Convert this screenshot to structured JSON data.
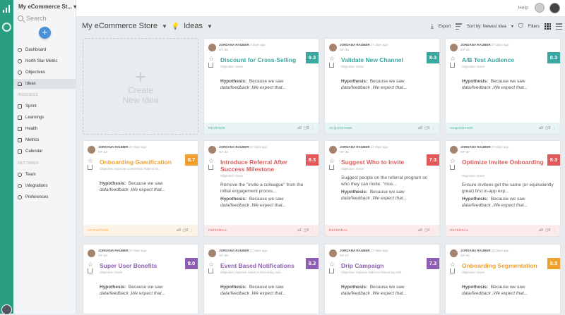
{
  "sidebar": {
    "store_name": "My eCommerce St...",
    "search_label": "Search",
    "add_label": "+",
    "items": [
      {
        "label": "Dashboard"
      },
      {
        "label": "North Star Metric"
      },
      {
        "label": "Objectives"
      },
      {
        "label": "Ideas"
      }
    ],
    "process_label": "PROCESS",
    "process_items": [
      {
        "label": "Sprint"
      },
      {
        "label": "Learnings"
      },
      {
        "label": "Health"
      },
      {
        "label": "Metrics"
      },
      {
        "label": "Calendar"
      }
    ],
    "settings_label": "SETTINGS",
    "settings_items": [
      {
        "label": "Team"
      },
      {
        "label": "Integrations"
      },
      {
        "label": "Preferences"
      }
    ]
  },
  "topbar": {
    "help": "Help"
  },
  "header": {
    "store": "My eCommerce Store",
    "section": "Ideas",
    "export": "Export",
    "sort": "Sort by: Newest Idea",
    "filters": "Filters"
  },
  "create_card": {
    "plus": "+",
    "line1": "Create",
    "line2": "New Idea"
  },
  "colors": {
    "teal": "#3aa8a0",
    "orange": "#f0a02f",
    "red": "#e05a5a",
    "purple": "#8e5fb0",
    "brand_green": "#2a9d80"
  },
  "cards": [
    {
      "author": "JORDANA RAUBER",
      "age": "3 days ago",
      "code": "GF-36",
      "title": "Discount for Cross-Selling",
      "score": "9.3",
      "objective": "Objective: None",
      "desc": "",
      "hyp_label": "Hypothesis:",
      "hyp1": "Because we saw",
      "hyp2": "data/feedback ,We expect that...",
      "category": "REVENUE",
      "links": "0",
      "comments": "0",
      "color": "#3aa8a0"
    },
    {
      "author": "JORDANA RAUBER",
      "age": "27 days ago",
      "code": "GF-35",
      "title": "Validate New Channel",
      "score": "8.3",
      "objective": "Objective: None",
      "desc": "",
      "hyp_label": "Hypothesis:",
      "hyp1": "Because we saw",
      "hyp2": "data/feedback ,We expect that...",
      "category": "ACQUISITION",
      "links": "0",
      "comments": "0",
      "color": "#3aa8a0"
    },
    {
      "author": "JORDANA RAUBER",
      "age": "27 days ago",
      "code": "GF-34",
      "title": "A/B Test Audience",
      "score": "8.3",
      "objective": "Objective: None",
      "desc": "",
      "hyp_label": "Hypothesis:",
      "hyp1": "Because we saw",
      "hyp2": "data/feedback ,We expect that...",
      "category": "ACQUISITION",
      "links": "0",
      "comments": "0",
      "color": "#3aa8a0"
    },
    {
      "author": "JORDANA RAUBER",
      "age": "27 days ago",
      "code": "GF-33",
      "title": "Onboarding Gamification",
      "score": "8.7",
      "objective": "Objective: Improve Conversion Rate of Or...",
      "desc": "",
      "hyp_label": "Hypothesis:",
      "hyp1": "Because we saw",
      "hyp2": "data/feedback ,We expect that...",
      "category": "ACTIVATION",
      "links": "0",
      "comments": "0",
      "color": "#f0a02f"
    },
    {
      "author": "JORDANA RAUBER",
      "age": "27 days ago",
      "code": "GF-32",
      "title": "Introduce Referral After Success Milestone",
      "score": "8.3",
      "objective": "Objective: None",
      "desc": "Remove the \"invite a colleague\" from the initial engagement proces...",
      "hyp_label": "Hypothesis:",
      "hyp1": "Because we saw",
      "hyp2": "data/feedback ,We expect that...",
      "category": "REFERRAL",
      "links": "1",
      "comments": "0",
      "color": "#e05a5a"
    },
    {
      "author": "JORDANA RAUBER",
      "age": "27 days ago",
      "code": "GF-31",
      "title": "Suggest Who to Invite",
      "score": "7.3",
      "objective": "Objective: None",
      "desc": "Suggest people on the referral program on who they can invite: \"mos...",
      "hyp_label": "Hypothesis:",
      "hyp1": "Because we saw",
      "hyp2": "data/feedback ,We expect that...",
      "category": "REFERRAL",
      "links": "0",
      "comments": "0",
      "color": "#e05a5a"
    },
    {
      "author": "JORDANA RAUBER",
      "age": "27 days ago",
      "code": "GF-30",
      "title": "Optimize Invitee Onboarding",
      "score": "8.3",
      "objective": "Objective: None",
      "desc": "Ensure invitees get the same (or equivalently great) first in-app exp...",
      "hyp_label": "Hypothesis:",
      "hyp1": "Because we saw",
      "hyp2": "data/feedback ,We expect that...",
      "category": "REFERRAL",
      "links": "0",
      "comments": "0",
      "color": "#e05a5a"
    },
    {
      "author": "JORDANA RAUBER",
      "age": "27 days ago",
      "code": "GF-29",
      "title": "Super User Benefits",
      "score": "8.0",
      "objective": "Objective: None",
      "desc": "",
      "hyp_label": "Hypothesis:",
      "hyp1": "Because we saw",
      "hyp2": "data/feedback ,We expect that...",
      "category": "",
      "links": "",
      "comments": "",
      "color": "#8e5fb0"
    },
    {
      "author": "JORDANA RAUBER",
      "age": "27 days ago",
      "code": "GF-28",
      "title": "Event Based Notifications",
      "score": "8.3",
      "objective": "Objective: Improve Sales to Recurring Visit...",
      "desc": "",
      "hyp_label": "Hypothesis:",
      "hyp1": "Because we saw",
      "hyp2": "data/feedback ,We expect that...",
      "category": "",
      "links": "",
      "comments": "",
      "color": "#8e5fb0"
    },
    {
      "author": "JORDANA RAUBER",
      "age": "27 days ago",
      "code": "GF-27",
      "title": "Drip Campaign",
      "score": "7.3",
      "objective": "Objective: Improve Sales to Recurring Visit",
      "desc": "",
      "hyp_label": "Hypothesis:",
      "hyp1": "Because we saw",
      "hyp2": "data/feedback ,We expect that...",
      "category": "",
      "links": "",
      "comments": "",
      "color": "#8e5fb0"
    },
    {
      "author": "JORDANA RAUBER",
      "age": "28 days ago",
      "code": "GF-26",
      "title": "Onboarding Segmentation",
      "score": "8.3",
      "objective": "Objective: None",
      "desc": "",
      "hyp_label": "Hypothesis:",
      "hyp1": "Because we saw",
      "hyp2": "data/feedback ,We expect that...",
      "category": "",
      "links": "",
      "comments": "",
      "color": "#f0a02f"
    }
  ]
}
